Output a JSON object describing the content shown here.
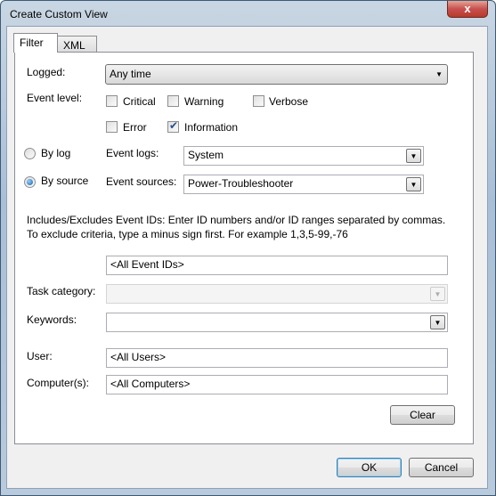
{
  "window": {
    "title": "Create Custom View",
    "close_label": "x"
  },
  "tabs": [
    {
      "label": "Filter"
    },
    {
      "label": "XML"
    }
  ],
  "filter": {
    "logged_label": "Logged:",
    "logged_value": "Any time",
    "event_level_label": "Event level:",
    "levels": [
      {
        "label": "Critical",
        "checked": false
      },
      {
        "label": "Warning",
        "checked": false
      },
      {
        "label": "Verbose",
        "checked": false
      },
      {
        "label": "Error",
        "checked": false
      },
      {
        "label": "Information",
        "checked": true
      }
    ],
    "by_log_label": "By log",
    "by_source_label": "By source",
    "selected_mode": "By source",
    "event_logs_label": "Event logs:",
    "event_logs_value": "System",
    "event_sources_label": "Event sources:",
    "event_sources_value": "Power-Troubleshooter",
    "event_ids_help": "Includes/Excludes Event IDs: Enter ID numbers and/or ID ranges separated by commas. To exclude criteria, type a minus sign first. For example 1,3,5-99,-76",
    "event_ids_value": "<All Event IDs>",
    "task_category_label": "Task category:",
    "task_category_value": "",
    "keywords_label": "Keywords:",
    "keywords_value": "",
    "user_label": "User:",
    "user_value": "<All Users>",
    "computer_label": "Computer(s):",
    "computer_value": "<All Computers>",
    "clear_label": "Clear"
  },
  "buttons": {
    "ok": "OK",
    "cancel": "Cancel"
  }
}
